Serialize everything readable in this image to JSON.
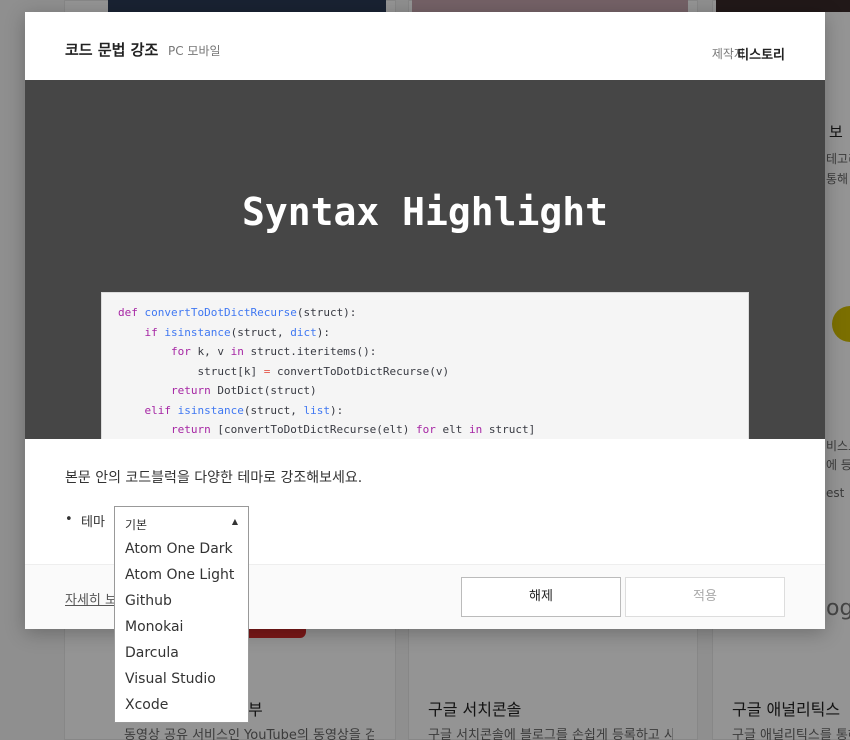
{
  "background": {
    "cards": [
      {
        "title": "",
        "desc": ""
      },
      {
        "title": "구글 서치콘솔",
        "desc": "구글 서치콘솔에 블로그를 손쉽게 등록하고 사"
      },
      {
        "title": "구글 애널리틱스",
        "desc": "구글 애널리틱스를 통해"
      }
    ],
    "youtube_card": {
      "title_suffix": "부",
      "desc": "동영상 공유 서비스인 YouTube의 동영상을 검"
    },
    "right_fragments": [
      "리",
      "보",
      "테고리",
      "통해",
      "비스트",
      "에 등",
      "est",
      "ogl"
    ]
  },
  "modal": {
    "title": "코드 문법 강조",
    "platform": "PC 모바일",
    "maker_label": "제작자",
    "maker_name": "티스토리",
    "preview_title": "Syntax Highlight",
    "code": [
      {
        "kw": "def ",
        "fn": "convertToDotDictRecurse",
        "rest": "(struct):"
      },
      {
        "indent": "    ",
        "kw": "if ",
        "fn": "isinstance",
        "rest": "(struct, ",
        "builtin": "dict",
        "tail": "):"
      },
      {
        "indent": "        ",
        "kw": "for ",
        "rest": "k, v ",
        "kw2": "in ",
        "tail": "struct.iteritems():"
      },
      {
        "indent": "            ",
        "rest": "struct[k] ",
        "op": "= ",
        "tail": "convertToDotDictRecurse(v)"
      },
      {
        "indent": "        ",
        "kw": "return ",
        "rest": "DotDict(struct)"
      },
      {
        "indent": "    ",
        "kw": "elif ",
        "fn": "isinstance",
        "rest": "(struct, ",
        "builtin": "list",
        "tail": "):"
      },
      {
        "indent": "        ",
        "kw": "return ",
        "rest": "[convertToDotDictRecurse(elt) ",
        "kw2": "for ",
        "tail": "elt ",
        "kw3": "in ",
        "tail2": "struct]"
      }
    ],
    "description": "본문 안의 코드블럭을 다양한 테마로 강조해보세요.",
    "theme_bullet": "•",
    "theme_label": "테마",
    "theme_select": {
      "selected": "기본",
      "options": [
        "Atom One Dark",
        "Atom One Light",
        "Github",
        "Monokai",
        "Darcula",
        "Visual Studio",
        "Xcode"
      ]
    },
    "detail_link": "자세히 보",
    "release_button": "해제",
    "apply_button": "적용"
  }
}
